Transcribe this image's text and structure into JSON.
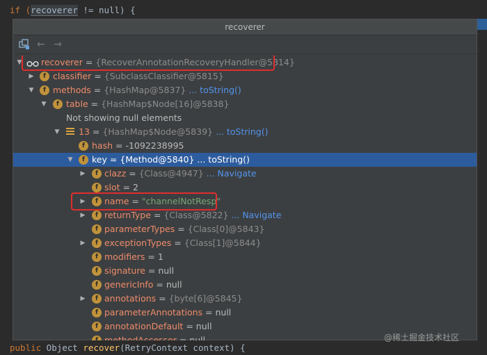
{
  "editor": {
    "top_line_prefix": "if (",
    "top_line_var": "recoverer",
    "top_line_suffix": " != null) {",
    "bottom_line_kw": "public",
    "bottom_line_type": " Object ",
    "bottom_line_method": "recover",
    "bottom_line_rest": "(RetryContext context) {"
  },
  "popup": {
    "title": "recoverer"
  },
  "tree": {
    "root": {
      "name": "recoverer",
      "eq": " = ",
      "ref": "{RecoverAnnotationRecoveryHandler@5814}"
    },
    "classifier": {
      "name": "classifier",
      "eq": " = ",
      "ref": "{SubclassClassifier@5815}"
    },
    "methods": {
      "name": "methods",
      "eq": " = ",
      "ref": "{HashMap@5837}",
      "link": " ... toString()"
    },
    "table": {
      "name": "table",
      "eq": " = ",
      "ref": "{HashMap$Node[16]@5838}"
    },
    "not_showing": "Not showing null elements",
    "entry13": {
      "name": "13",
      "eq": " = ",
      "ref": "{HashMap$Node@5839}",
      "link": " ... toString()"
    },
    "hash": {
      "name": "hash",
      "eq": " = ",
      "val": "-1092238995"
    },
    "key": {
      "name": "key",
      "eq": " = ",
      "val": "{Method@5840}",
      "link": " ... toString()"
    },
    "clazz": {
      "name": "clazz",
      "eq": " = ",
      "ref": "{Class@4947}",
      "link": " ... Navigate"
    },
    "slot": {
      "name": "slot",
      "eq": " = ",
      "val": "2"
    },
    "mname": {
      "name": "name",
      "eq": " = ",
      "str": "\"channelNotResp\""
    },
    "returnType": {
      "name": "returnType",
      "eq": " = ",
      "ref": "{Class@5822}",
      "link": " ... Navigate"
    },
    "parameterTypes": {
      "name": "parameterTypes",
      "eq": " = ",
      "ref": "{Class[0]@5843}"
    },
    "exceptionTypes": {
      "name": "exceptionTypes",
      "eq": " = ",
      "ref": "{Class[1]@5844}"
    },
    "modifiers": {
      "name": "modifiers",
      "eq": " = ",
      "val": "1"
    },
    "signature": {
      "name": "signature",
      "eq": " = ",
      "val": "null"
    },
    "genericInfo": {
      "name": "genericInfo",
      "eq": " = ",
      "val": "null"
    },
    "annotations": {
      "name": "annotations",
      "eq": " = ",
      "ref": "{byte[6]@5845}"
    },
    "parameterAnnotations": {
      "name": "parameterAnnotations",
      "eq": " = ",
      "val": "null"
    },
    "annotationDefault": {
      "name": "annotationDefault",
      "eq": " = ",
      "val": "null"
    },
    "methodAccessor": {
      "name": "methodAccessor",
      "eq": " = ",
      "val": "null"
    }
  },
  "icon_letter": "f",
  "watermark": "@稀土掘金技术社区",
  "colors": {
    "selection": "#2d5c9e",
    "highlight_box": "#e02d2d",
    "field_icon": "#c0923b"
  }
}
